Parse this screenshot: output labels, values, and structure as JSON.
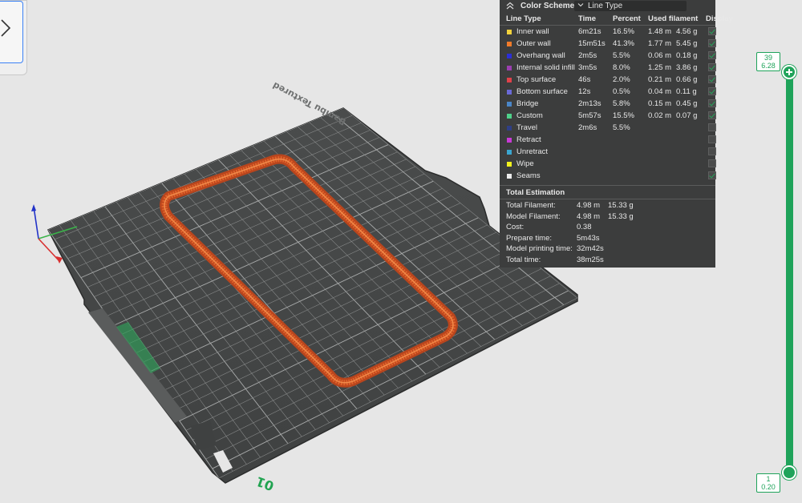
{
  "legend": {
    "title": "Color Scheme",
    "scheme_value": "Line Type",
    "columns": {
      "line_type": "Line Type",
      "time": "Time",
      "percent": "Percent",
      "used_filament": "Used filament",
      "display": "Display"
    },
    "rows": [
      {
        "name": "Inner wall",
        "color": "#f2d23c",
        "time": "6m21s",
        "percent": "16.5%",
        "meters": "1.48 m",
        "grams": "4.56 g",
        "display": true
      },
      {
        "name": "Outer wall",
        "color": "#f07b2a",
        "time": "15m51s",
        "percent": "41.3%",
        "meters": "1.77 m",
        "grams": "5.45 g",
        "display": true
      },
      {
        "name": "Overhang wall",
        "color": "#2b2fd8",
        "time": "2m5s",
        "percent": "5.5%",
        "meters": "0.06 m",
        "grams": "0.18 g",
        "display": true
      },
      {
        "name": "Internal solid infill",
        "color": "#9b3fb0",
        "time": "3m5s",
        "percent": "8.0%",
        "meters": "1.25 m",
        "grams": "3.86 g",
        "display": true
      },
      {
        "name": "Top surface",
        "color": "#e0424a",
        "time": "46s",
        "percent": "2.0%",
        "meters": "0.21 m",
        "grams": "0.66 g",
        "display": true
      },
      {
        "name": "Bottom surface",
        "color": "#6a6ad8",
        "time": "12s",
        "percent": "0.5%",
        "meters": "0.04 m",
        "grams": "0.11 g",
        "display": true
      },
      {
        "name": "Bridge",
        "color": "#4a86c8",
        "time": "2m13s",
        "percent": "5.8%",
        "meters": "0.15 m",
        "grams": "0.45 g",
        "display": true
      },
      {
        "name": "Custom",
        "color": "#4fd18a",
        "time": "5m57s",
        "percent": "15.5%",
        "meters": "0.02 m",
        "grams": "0.07 g",
        "display": true
      },
      {
        "name": "Travel",
        "color": "#2f3f86",
        "time": "2m6s",
        "percent": "5.5%",
        "meters": "",
        "grams": "",
        "display": false
      },
      {
        "name": "Retract",
        "color": "#c83ad6",
        "time": "",
        "percent": "",
        "meters": "",
        "grams": "",
        "display": false
      },
      {
        "name": "Unretract",
        "color": "#3aa6d0",
        "time": "",
        "percent": "",
        "meters": "",
        "grams": "",
        "display": false
      },
      {
        "name": "Wipe",
        "color": "#f2f21e",
        "time": "",
        "percent": "",
        "meters": "",
        "grams": "",
        "display": false
      },
      {
        "name": "Seams",
        "color": "#ececec",
        "time": "",
        "percent": "",
        "meters": "",
        "grams": "",
        "display": true
      }
    ],
    "estimation_title": "Total Estimation",
    "estimation": [
      {
        "label": "Total Filament:",
        "v1": "4.98 m",
        "v2": "15.33 g"
      },
      {
        "label": "Model Filament:",
        "v1": "4.98 m",
        "v2": "15.33 g"
      },
      {
        "label": "Cost:",
        "v1": "0.38",
        "v2": ""
      },
      {
        "label": "Prepare time:",
        "v1": "5m43s",
        "v2": ""
      },
      {
        "label": "Model printing time:",
        "v1": "32m42s",
        "v2": ""
      },
      {
        "label": "Total time:",
        "v1": "38m25s",
        "v2": ""
      }
    ]
  },
  "slider": {
    "top_layer": "39",
    "top_height": "6.28",
    "bottom_layer": "1",
    "bottom_height": "0.20",
    "color": "#1fa35a"
  },
  "plate": {
    "brand_text": "Bambu Textured",
    "plate_number": "01",
    "model_color": "#e0622a"
  },
  "icons": {
    "toolbar": "chevron-right-icon",
    "collapse": "chevron-up-icon",
    "dropdown": "chevron-down-icon"
  }
}
